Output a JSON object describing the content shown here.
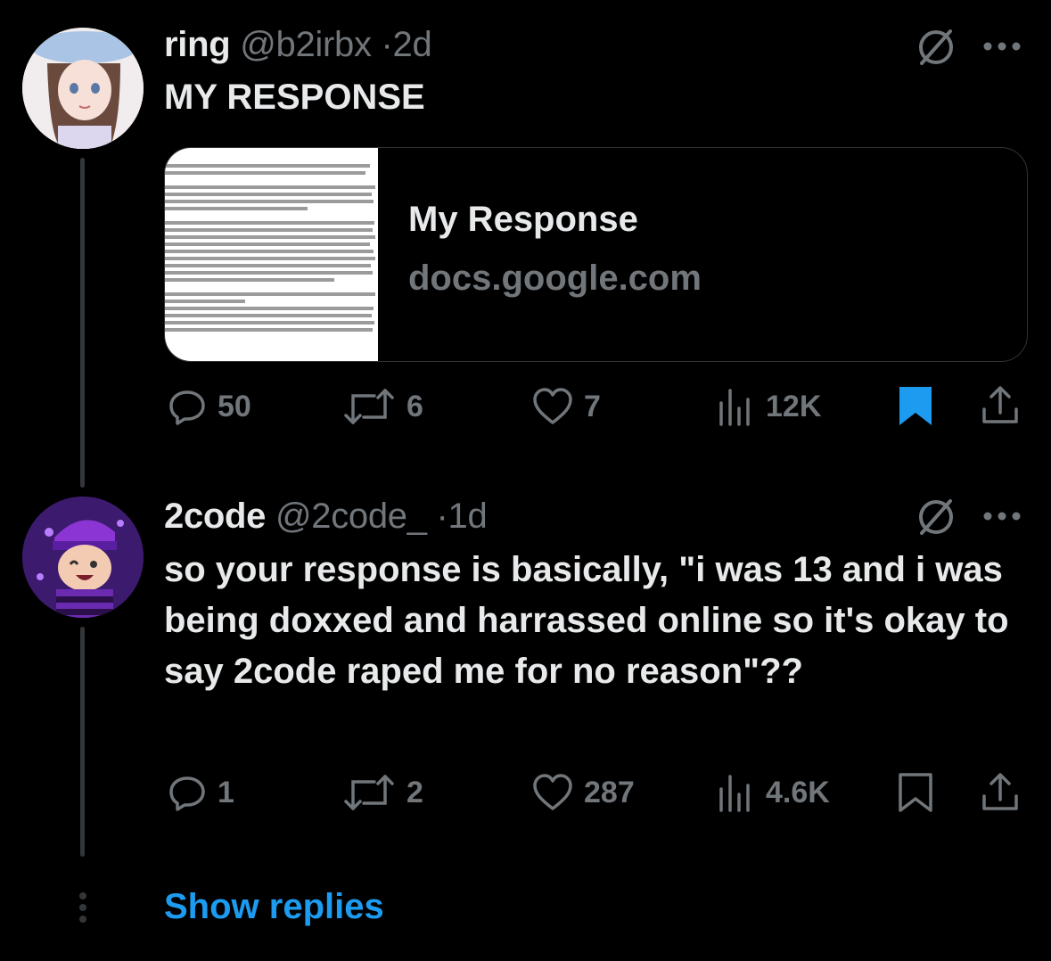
{
  "post1": {
    "display_name": "ring",
    "handle": "@b2irbx",
    "separator": "·",
    "time": "2d",
    "text": "MY RESPONSE",
    "card": {
      "title": "My Response",
      "domain": "docs.google.com"
    },
    "actions": {
      "replies": "50",
      "reposts": "6",
      "likes": "7",
      "views": "12K",
      "bookmarked": true
    }
  },
  "post2": {
    "display_name": "2code",
    "handle": "@2code_",
    "separator": "·",
    "time": "1d",
    "text": "so your response is basically, \"i was 13 and i was being doxxed and harrassed online so it's okay to say 2code raped me for no reason\"??",
    "actions": {
      "replies": "1",
      "reposts": "2",
      "likes": "287",
      "views": "4.6K",
      "bookmarked": false
    }
  },
  "footer": {
    "show_replies": "Show replies"
  },
  "colors": {
    "background": "#000000",
    "text": "#e7e9ea",
    "muted": "#71767b",
    "accent": "#1d9bf0"
  }
}
